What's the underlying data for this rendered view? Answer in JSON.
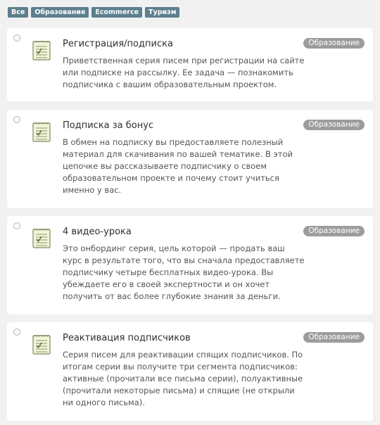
{
  "filters": [
    "Все",
    "Образование",
    "Ecommerce",
    "Туризм"
  ],
  "cards": [
    {
      "title": "Регистрация/подписка",
      "badge": "Образование",
      "description": "Приветственная серия писем при регистрации на сайте или подписке на рассылку. Ее задача — познакомить подписчика с вашим образовательным проектом."
    },
    {
      "title": "Подписка за бонус",
      "badge": "Образование",
      "description": "В обмен на подписку вы предоставляете полезный материал для скачивания по вашей тематике. В этой цепочке вы рассказываете подписчику о своем образовательном проекте и почему стоит учиться именно у вас."
    },
    {
      "title": "4 видео-урока",
      "badge": "Образование",
      "description": "Это онбординг серия, цель которой — продать ваш курс в результате того, что вы сначала предоставляете подписчику четыре бесплатных видео-урока. Вы убеждаете его в своей экспертности и он хочет получить от вас более глубокие знания за деньги."
    },
    {
      "title": "Реактивация подписчиков",
      "badge": "Образование",
      "description": "Серия писем для реактивации спящих подписчиков. По итогам серии вы получите три сегмента подписчиков: активные (прочитали все письма серии), полуактивные (прочитали некоторые письма) и спящие (не открыли ни одного письма)."
    }
  ]
}
